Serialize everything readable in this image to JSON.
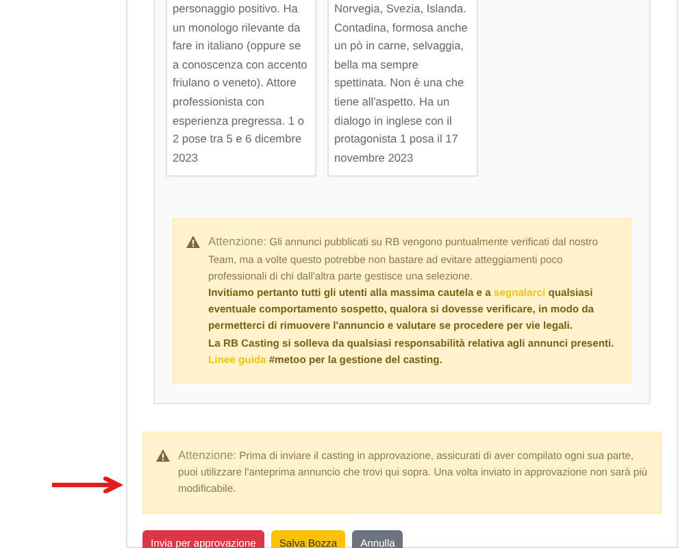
{
  "cards": [
    {
      "text": "personaggio positivo. Ha un monologo rilevante da fare in italiano (oppure se a conoscenza con accento friulano o veneto). Attore professionista con esperienza pregressa. 1 o 2 pose tra 5 e 6 dicembre 2023"
    },
    {
      "text": "Norvegia, Svezia, Islanda. Contadina, formosa anche un pò in carne, selvaggia, bella ma sempre spettinata. Non è una che tiene all'aspetto. Ha un dialogo in inglese con il protagonista 1 posa il 17 novembre 2023"
    }
  ],
  "notice": {
    "label": "Attenzione:",
    "text": "Gli annunci pubblicati su RB vengono puntualmente verificati dal nostro Team, ma a volte questo potrebbe non bastare ad evitare atteggiamenti poco professionali di chi dall'altra parte gestisce una selezione.",
    "bold_before": "Invitiamo pertanto tutti gli utenti alla massima cautela e a",
    "report_link": "segnalarci",
    "bold_after": "qualsiasi eventuale comportamento sospetto, qualora si dovesse verificare, in modo da permetterci di rimuovere l'annuncio e valutare se procedere per vie legali.",
    "disclaimer": "La RB Casting si solleva da qualsiasi responsabilità relativa agli annunci presenti.",
    "guide_link": "Linee guida",
    "guide_text": "#metoo per la gestione del casting."
  },
  "approval_notice": {
    "label": "Attenzione:",
    "text": "Prima di inviare il casting in approvazione, assicurati di aver compilato ogni sua parte, puoi utilizzare l'anteprima annuncio che trovi qui sopra. Una volta inviato in approvazione non sarà più modificabile."
  },
  "buttons": [
    {
      "label": "Invia per approvazione",
      "kind": "danger"
    },
    {
      "label": "Salva Bozza",
      "kind": "warning"
    },
    {
      "label": "Annulla",
      "kind": "secondary"
    }
  ]
}
